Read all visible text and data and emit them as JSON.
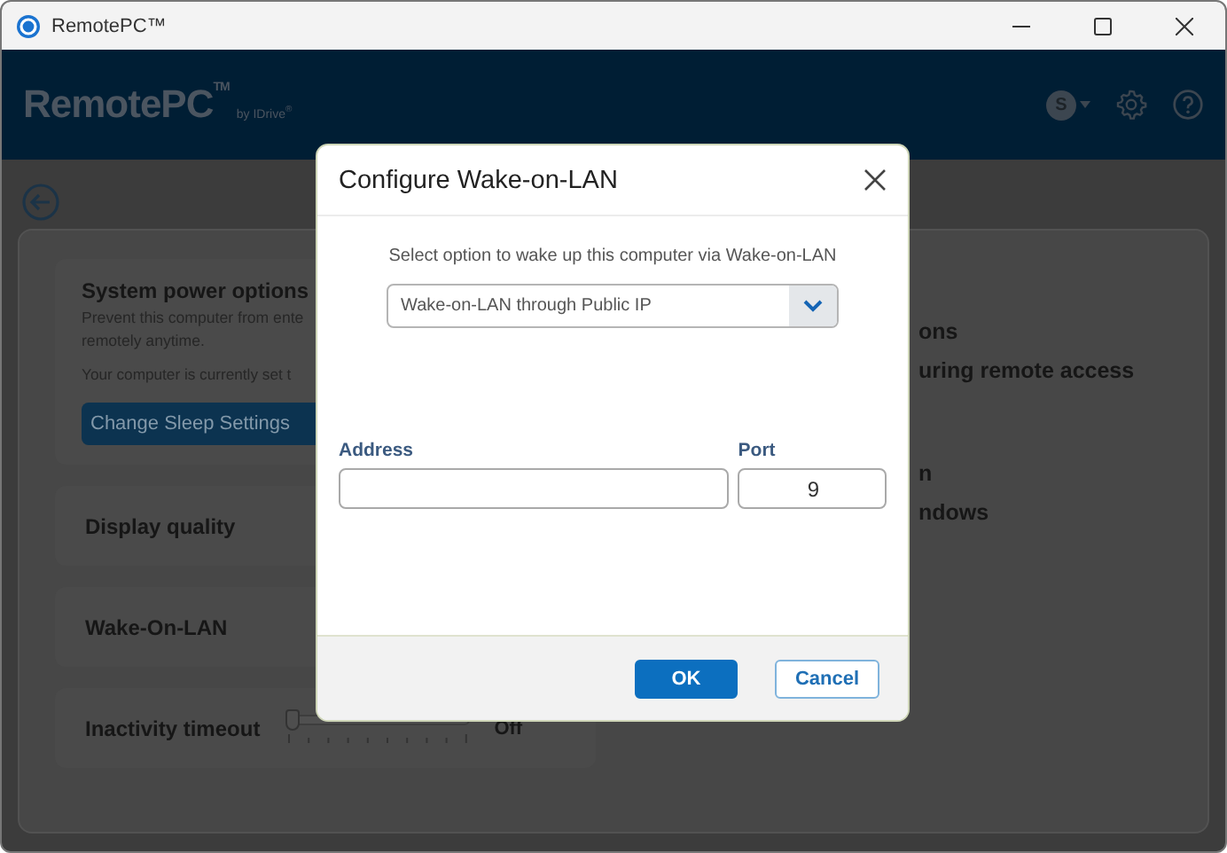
{
  "window": {
    "title": "RemotePC™"
  },
  "header": {
    "logo": "RemotePC$^{TM}$",
    "byline": "by IDrive$^{®}$",
    "avatar": "S"
  },
  "settings": {
    "cards": [
      {
        "kind": "power",
        "title": "System power options",
        "lines": [
          "Prevent this computer from ente",
          "remotely anytime."
        ],
        "status": "Your computer is currently set t",
        "button": "Change Sleep Settings"
      },
      {
        "kind": "plain",
        "title": "Display quality"
      },
      {
        "kind": "plain",
        "title": "Wake-On-LAN"
      },
      {
        "kind": "slider",
        "title": "Inactivity timeout",
        "level": 0,
        "reading": "Off"
      }
    ],
    "right_groups": [
      {
        "lines": [
          "ons",
          "uring remote access"
        ]
      },
      {
        "lines": [
          "n",
          "ndows"
        ]
      }
    ]
  },
  "dialog": {
    "title": "Configure Wake-on-LAN",
    "instruction": "Select option to wake up this computer via Wake-on-LAN",
    "dropdown": {
      "value": "Wake-on-LAN through Public IP"
    },
    "fields": [
      {
        "kind": "address",
        "label": "Address"
      },
      {
        "kind": "port",
        "label": "Port",
        "value": "9"
      }
    ],
    "buttons": [
      {
        "kind": "primary",
        "label": "OK"
      },
      {
        "kind": "secondary",
        "label": "Cancel"
      }
    ]
  }
}
